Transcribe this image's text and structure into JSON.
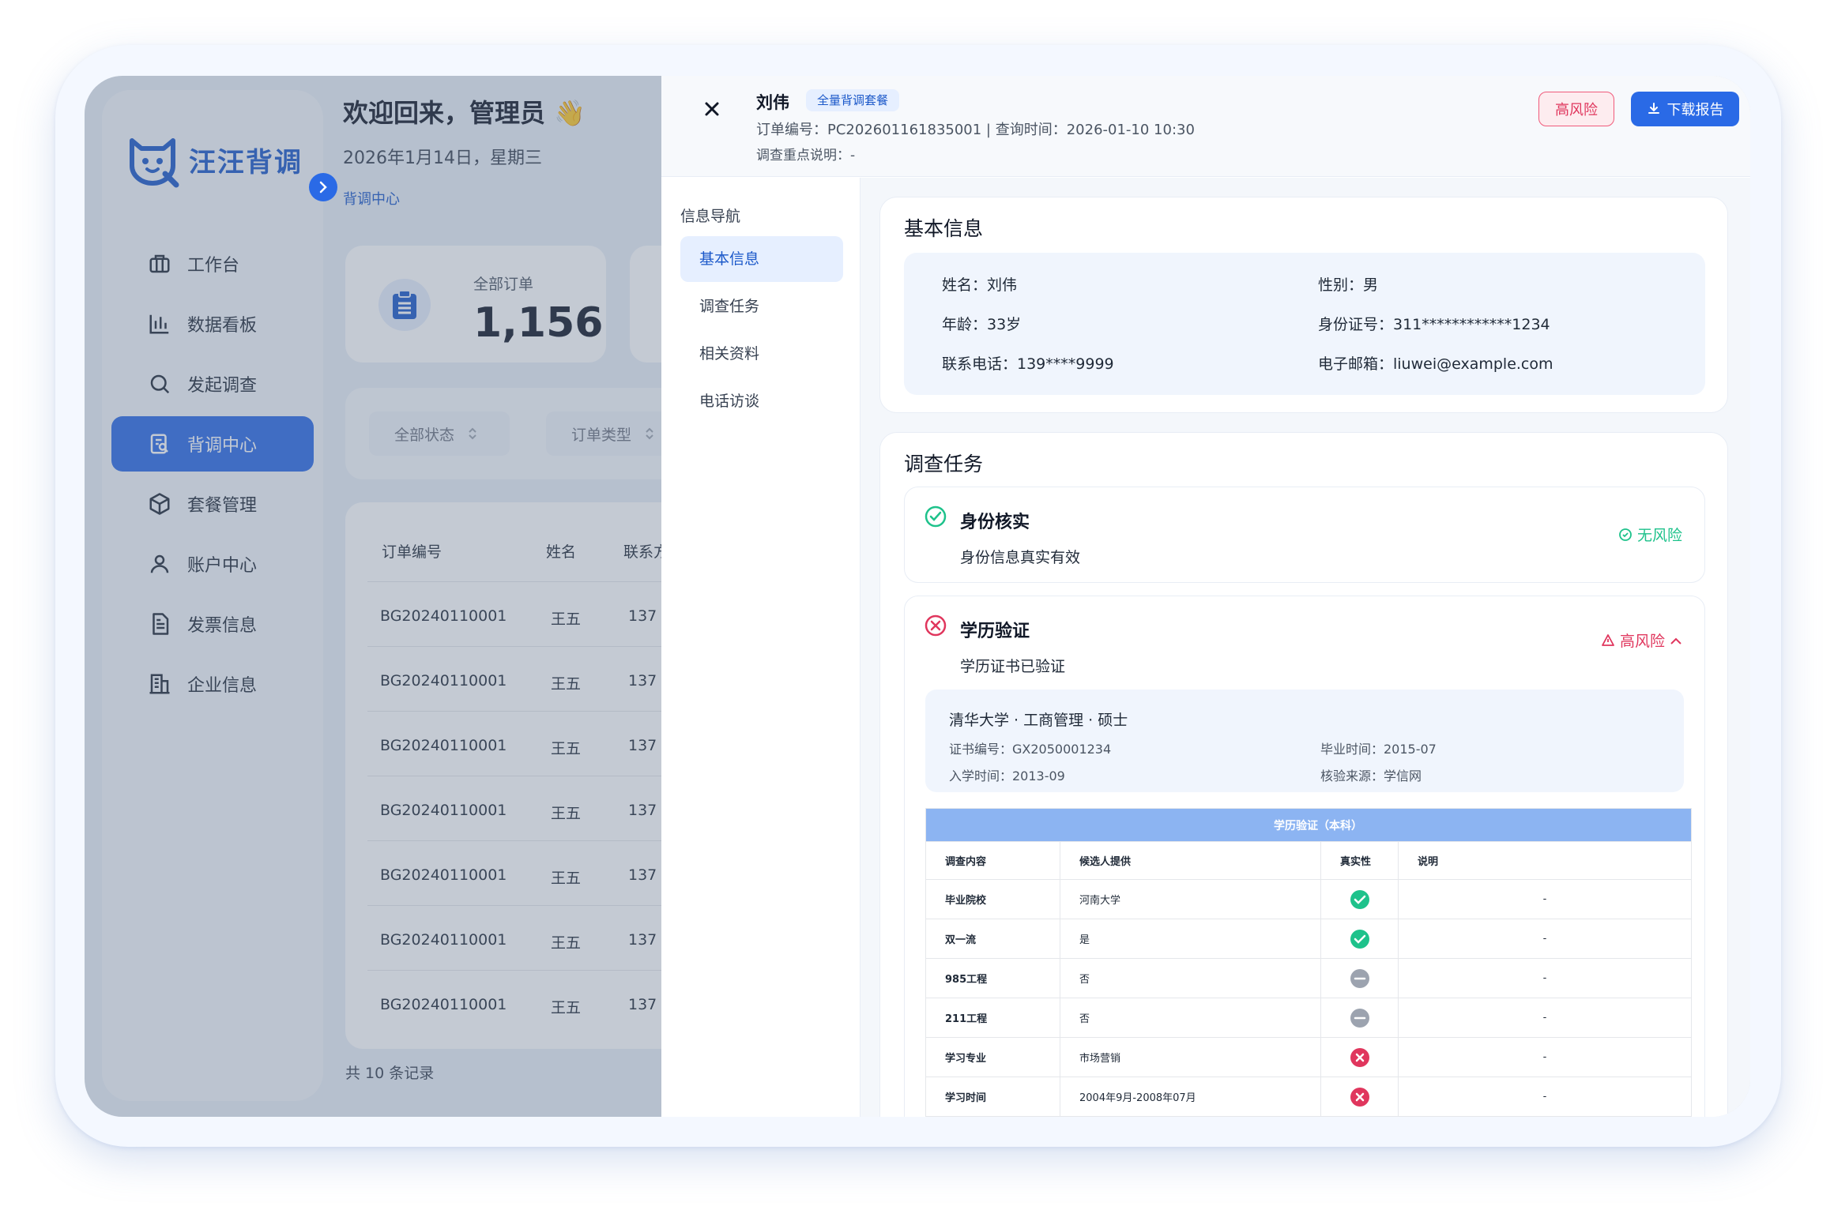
{
  "brand": {
    "name": "汪汪背调"
  },
  "sidebar": {
    "items": [
      {
        "label": "工作台",
        "icon": "briefcase-icon"
      },
      {
        "label": "数据看板",
        "icon": "bar-chart-icon"
      },
      {
        "label": "发起调查",
        "icon": "search-icon"
      },
      {
        "label": "背调中心",
        "icon": "report-search-icon",
        "active": true
      },
      {
        "label": "套餐管理",
        "icon": "package-icon"
      },
      {
        "label": "账户中心",
        "icon": "user-icon"
      },
      {
        "label": "发票信息",
        "icon": "invoice-icon"
      },
      {
        "label": "企业信息",
        "icon": "building-icon"
      }
    ]
  },
  "header": {
    "welcome": "欢迎回来，管理员 👋",
    "date": "2026年1月14日，星期三",
    "breadcrumb": "背调中心"
  },
  "stats": {
    "total_label": "全部订单",
    "total_value": "1,156"
  },
  "filters": {
    "status": "全部状态",
    "type": "订单类型"
  },
  "table": {
    "columns": [
      "订单编号",
      "姓名",
      "联系方"
    ],
    "rows": [
      [
        "BG20240110001",
        "王五",
        "137"
      ],
      [
        "BG20240110001",
        "王五",
        "137"
      ],
      [
        "BG20240110001",
        "王五",
        "137"
      ],
      [
        "BG20240110001",
        "王五",
        "137"
      ],
      [
        "BG20240110001",
        "王五",
        "137"
      ],
      [
        "BG20240110001",
        "王五",
        "137"
      ],
      [
        "BG20240110001",
        "王五",
        "137"
      ]
    ],
    "total": "共 10 条记录"
  },
  "drawer": {
    "name": "刘伟",
    "package": "全量背调套餐",
    "order_line": "订单编号：PC202601161835001 | 查询时间：2026-01-10 10:30",
    "note": "调查重点说明：-",
    "risk_button": "高风险",
    "download_button": "下载报告",
    "nav_title": "信息导航",
    "nav_items": [
      "基本信息",
      "调查任务",
      "相关资料",
      "电话访谈"
    ],
    "basic": {
      "title": "基本信息",
      "name": "姓名：刘伟",
      "gender": "性别：男",
      "age": "年龄：33岁",
      "id_no": "身份证号：311************1234",
      "phone": "联系电话：139****9999",
      "email": "电子邮箱：liuwei@example.com"
    },
    "tasks": {
      "title": "调查任务",
      "identity": {
        "name": "身份核实",
        "desc": "身份信息真实有效",
        "risk": "无风险",
        "status_icon": "check-circle-icon"
      },
      "education": {
        "name": "学历验证",
        "desc": "学历证书已验证",
        "risk": "高风险",
        "status_icon": "x-circle-icon",
        "school_line": "清华大学 · 工商管理 · 硕士",
        "cert_no": "证书编号：GX2050001234",
        "grad_time": "毕业时间：2015-07",
        "enroll_time": "入学时间：2013-09",
        "source": "核验来源：学信网",
        "table_caption": "学历验证（本科）",
        "table_headers": [
          "调查内容",
          "候选人提供",
          "真实性",
          "说明"
        ],
        "table_rows": [
          {
            "item": "毕业院校",
            "provided": "河南大学",
            "status": "verified",
            "note": "-"
          },
          {
            "item": "双一流",
            "provided": "是",
            "status": "verified",
            "note": "-"
          },
          {
            "item": "985工程",
            "provided": "否",
            "status": "neutral",
            "note": "-"
          },
          {
            "item": "211工程",
            "provided": "否",
            "status": "neutral",
            "note": "-"
          },
          {
            "item": "学习专业",
            "provided": "市场营销",
            "status": "failed",
            "note": "-"
          },
          {
            "item": "学习时间",
            "provided": "2004年9月-2008年07月",
            "status": "failed",
            "note": "-"
          }
        ]
      }
    }
  },
  "colors": {
    "primary": "#2a6ae6",
    "danger": "#e0365d",
    "success": "#1ec28b",
    "neutral": "#9ca3af"
  }
}
